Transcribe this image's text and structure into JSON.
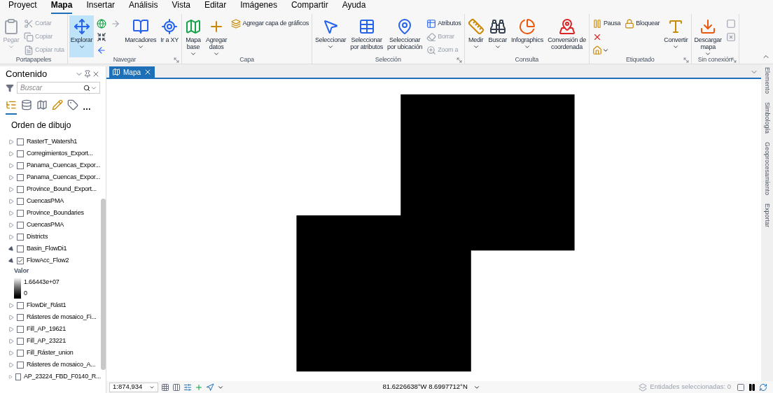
{
  "menu_tabs": [
    {
      "label": "Proyect",
      "selected": false
    },
    {
      "label": "Mapa",
      "selected": true
    },
    {
      "label": "Insertar",
      "selected": false
    },
    {
      "label": "Análisis",
      "selected": false
    },
    {
      "label": "Vista",
      "selected": false
    },
    {
      "label": "Editar",
      "selected": false
    },
    {
      "label": "Imágenes",
      "selected": false
    },
    {
      "label": "Compartir",
      "selected": false
    },
    {
      "label": "Ayuda",
      "selected": false
    }
  ],
  "ribbon": [
    {
      "label": "Portapapeles",
      "launcher": false,
      "buttons": [
        {
          "kind": "large",
          "label": "Pegar",
          "dropdown": true,
          "disabled": true,
          "selected": false
        },
        {
          "kind": "small",
          "label": "Cortar",
          "dropdown": false,
          "disabled": true,
          "selected": false
        },
        {
          "kind": "small",
          "label": "Copiar",
          "dropdown": false,
          "disabled": true,
          "selected": false
        },
        {
          "kind": "small",
          "label": "Copiar ruta",
          "dropdown": false,
          "disabled": true,
          "selected": false
        }
      ]
    },
    {
      "label": "Navegar",
      "launcher": true,
      "buttons": [
        {
          "kind": "large",
          "label": "Explorar",
          "dropdown": true,
          "disabled": false,
          "selected": true
        },
        {
          "kind": "icon",
          "dropdown": false,
          "disabled": false,
          "selected": false
        },
        {
          "kind": "icon",
          "dropdown": false,
          "disabled": false,
          "selected": false
        },
        {
          "kind": "icon",
          "dropdown": false,
          "disabled": false,
          "selected": false
        },
        {
          "kind": "icon",
          "dropdown": false,
          "disabled": true,
          "selected": false
        },
        {
          "kind": "large",
          "label": "Marcadores",
          "dropdown": true,
          "disabled": false,
          "selected": false
        },
        {
          "kind": "large",
          "label": "Ir a XY",
          "dropdown": false,
          "disabled": false,
          "selected": false
        }
      ]
    },
    {
      "label": "Capa",
      "launcher": false,
      "buttons": [
        {
          "kind": "large",
          "label": "Mapa\nbase",
          "dropdown": true,
          "disabled": false,
          "selected": false
        },
        {
          "kind": "large",
          "label": "Agregar\ndatos",
          "dropdown": true,
          "disabled": false,
          "selected": false
        },
        {
          "kind": "small",
          "label": "Agregar capa de gráficos",
          "dropdown": false,
          "disabled": false,
          "selected": false
        }
      ]
    },
    {
      "label": "Selección",
      "launcher": true,
      "buttons": [
        {
          "kind": "large",
          "label": "Seleccionar",
          "dropdown": true,
          "disabled": false,
          "selected": false
        },
        {
          "kind": "large",
          "label": "Seleccionar\npor atributos",
          "dropdown": false,
          "disabled": false,
          "selected": false
        },
        {
          "kind": "large",
          "label": "Seleccionar\npor ubicación",
          "dropdown": false,
          "disabled": false,
          "selected": false
        },
        {
          "kind": "small",
          "label": "Atributos",
          "dropdown": false,
          "disabled": false,
          "selected": false
        },
        {
          "kind": "small",
          "label": "Borrar",
          "dropdown": false,
          "disabled": true,
          "selected": false
        },
        {
          "kind": "small",
          "label": "Zoom a",
          "dropdown": false,
          "disabled": true,
          "selected": false
        }
      ]
    },
    {
      "label": "Consulta",
      "launcher": false,
      "buttons": [
        {
          "kind": "large",
          "label": "Medir",
          "dropdown": true,
          "disabled": false,
          "selected": false
        },
        {
          "kind": "large",
          "label": "Buscar",
          "dropdown": true,
          "disabled": false,
          "selected": false
        },
        {
          "kind": "large",
          "label": "Infographics",
          "dropdown": true,
          "disabled": false,
          "selected": false
        },
        {
          "kind": "large",
          "label": "Conversión de\ncoordenada",
          "dropdown": false,
          "disabled": false,
          "selected": false
        }
      ]
    },
    {
      "label": "Etiquetado",
      "launcher": true,
      "buttons": [
        {
          "kind": "small",
          "label": "Pausa",
          "dropdown": false,
          "disabled": false,
          "selected": false
        },
        {
          "kind": "icon",
          "dropdown": false,
          "disabled": false,
          "selected": false
        },
        {
          "kind": "icon",
          "dropdown": true,
          "disabled": false,
          "selected": false
        },
        {
          "kind": "small",
          "label": "Bloquear",
          "dropdown": false,
          "disabled": false,
          "selected": false
        },
        {
          "kind": "large",
          "label": "Convertir",
          "dropdown": true,
          "disabled": false,
          "selected": false
        }
      ]
    },
    {
      "label": "Sin conexión",
      "launcher": true,
      "buttons": [
        {
          "kind": "large",
          "label": "Descargar\nmapa",
          "dropdown": true,
          "disabled": false,
          "selected": false
        },
        {
          "kind": "icon",
          "dropdown": false,
          "disabled": true,
          "selected": false
        },
        {
          "kind": "icon",
          "dropdown": false,
          "disabled": true,
          "selected": false
        }
      ]
    }
  ],
  "contents": {
    "title": "Contenido",
    "search": {
      "placeholder": "Buscar"
    },
    "view_tabs": [
      {
        "selected": true
      },
      {
        "selected": false
      },
      {
        "selected": false
      },
      {
        "selected": false
      },
      {
        "selected": false
      }
    ],
    "more": "…",
    "heading": "Orden de dibujo",
    "layers": [
      {
        "name": "RasterT_Watersh1",
        "checked": false,
        "expanded": false
      },
      {
        "name": "Corregimientos_Export...",
        "checked": false,
        "expanded": false
      },
      {
        "name": "Panama_Cuencas_Expor...",
        "checked": false,
        "expanded": false
      },
      {
        "name": "Panama_Cuencas_Expor...",
        "checked": false,
        "expanded": false
      },
      {
        "name": "Province_Bound_Export...",
        "checked": false,
        "expanded": false
      },
      {
        "name": "CuencasPMA",
        "checked": false,
        "expanded": false
      },
      {
        "name": "Province_Boundaries",
        "checked": false,
        "expanded": false
      },
      {
        "name": "CuencasPMA",
        "checked": false,
        "expanded": false
      },
      {
        "name": "Districts",
        "checked": false,
        "expanded": false
      },
      {
        "name": "Basin_FlowDi1",
        "checked": false,
        "expanded": true
      },
      {
        "name": "FlowAcc_Flow2",
        "checked": true,
        "expanded": true,
        "legend": {
          "label": "Valor",
          "high": "1.66443e+07",
          "low": "0"
        }
      },
      {
        "name": "FlowDir_Rást1",
        "checked": false,
        "expanded": false
      },
      {
        "name": "Rásteres de mosaico_Fi...",
        "checked": false,
        "expanded": false
      },
      {
        "name": "Fill_AP_19621",
        "checked": false,
        "expanded": false
      },
      {
        "name": "Fill_AP_23221",
        "checked": false,
        "expanded": false
      },
      {
        "name": "Fill_Ráster_union",
        "checked": false,
        "expanded": false
      },
      {
        "name": "Rásteres de mosaico_A...",
        "checked": false,
        "expanded": false
      },
      {
        "name": "AP_23224_FBD_F0140_R...",
        "checked": false,
        "expanded": false
      }
    ]
  },
  "map_tab": {
    "label": "Mapa",
    "selected": true
  },
  "side_tabs": [
    "Elemento",
    "Simbología",
    "Geoprocesamiento",
    "Exportar"
  ],
  "status_bar": {
    "scale": "1:874,934",
    "coordinates": "81.6226638°W 8.6997712°N",
    "selection": "Entidades seleccionadas: 0"
  }
}
